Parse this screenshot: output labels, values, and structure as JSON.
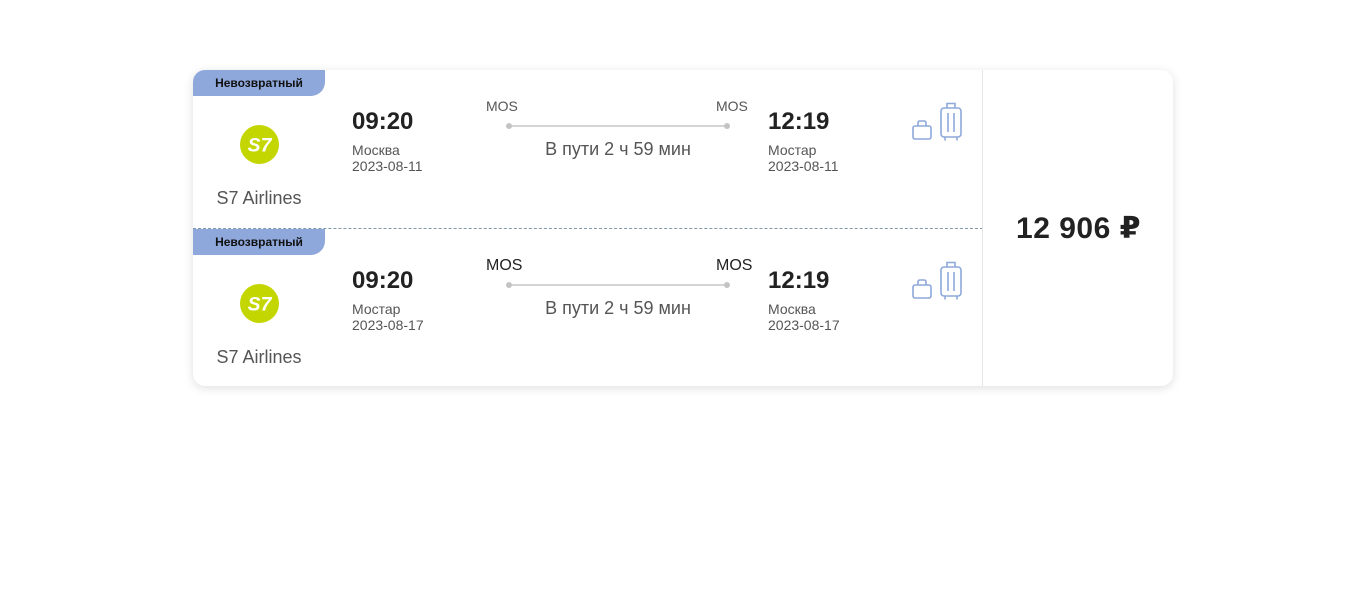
{
  "currency_price": "12 906 ₽",
  "segments": [
    {
      "badge": "Невозвратный",
      "airline": "S7 Airlines",
      "logo_text": "S7",
      "departure": {
        "time": "09:20",
        "city": "Москва",
        "date": "2023-08-11",
        "code": "MOS"
      },
      "arrival": {
        "time": "12:19",
        "city": "Мостар",
        "date": "2023-08-11",
        "code": "MOS"
      },
      "duration": "В пути 2 ч 59 мин",
      "icons": [
        "hand-bag-icon",
        "suitcase-icon"
      ]
    },
    {
      "badge": "Невозвратный",
      "airline": "S7 Airlines",
      "logo_text": "S7",
      "departure": {
        "time": "09:20",
        "city": "Мостар",
        "date": "2023-08-17",
        "code": "MOS"
      },
      "arrival": {
        "time": "12:19",
        "city": "Москва",
        "date": "2023-08-17",
        "code": "MOS"
      },
      "duration": "В пути 2 ч 59 мин",
      "icons": [
        "hand-bag-icon",
        "suitcase-icon"
      ]
    }
  ],
  "colors": {
    "badge_bg": "#8ea8dc",
    "s7_logo": "#c4d600",
    "icon_stroke": "#8ea8dc"
  }
}
